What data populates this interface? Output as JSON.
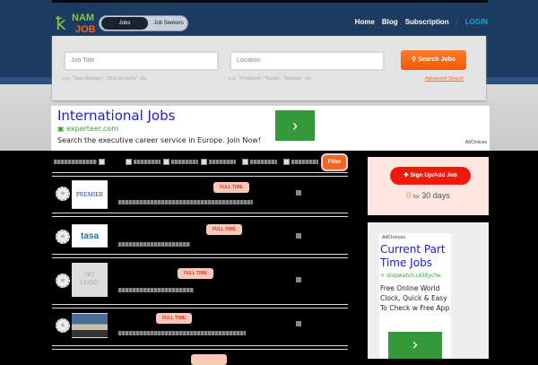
{
  "header": {
    "logo_top": "NAM",
    "logo_bottom": "JOB",
    "toggle": [
      "Jobs",
      "Job Seekers"
    ],
    "nav": [
      "Home",
      "Blog",
      "Subscription"
    ],
    "login": "LOGIN"
  },
  "search": {
    "title_placeholder": "Job Title",
    "location_placeholder": "Location",
    "title_hint": "e.g.: \"Sale Manager\", \"Web Designer\", etc.",
    "location_hint": "e.g.: \"Windhoek\", \"Rundu\", \"Namibia\", etc.",
    "button": "Search Jobs",
    "advanced": "Advanced Search"
  },
  "ad_top": {
    "title": "International Jobs",
    "url": "experteer.com",
    "desc": "Search the executive career service in Europe. Join Now!",
    "arrow": "›",
    "adchoices": "AdChoices"
  },
  "filter": {
    "button": "Filter"
  },
  "jobs": [
    {
      "logo": "PREMIER",
      "type": "FULL TIME"
    },
    {
      "logo": "tasa",
      "type": "FULL TIME"
    },
    {
      "logo": "NO LOGO",
      "type": "FULL TIME"
    },
    {
      "logo": "",
      "type": "FULL TIME"
    }
  ],
  "sidebar": {
    "signup": "Sign Up/Add Job",
    "count": "0",
    "for": "for",
    "period": "30 days"
  },
  "ad_side": {
    "adchoices": "AdChoices",
    "title": "Current Part Time Jobs",
    "url": "stopwatch.utilityche.",
    "desc": "Free Online World Clock, Quick & Easy To Check w Free App",
    "arrow": "›"
  }
}
